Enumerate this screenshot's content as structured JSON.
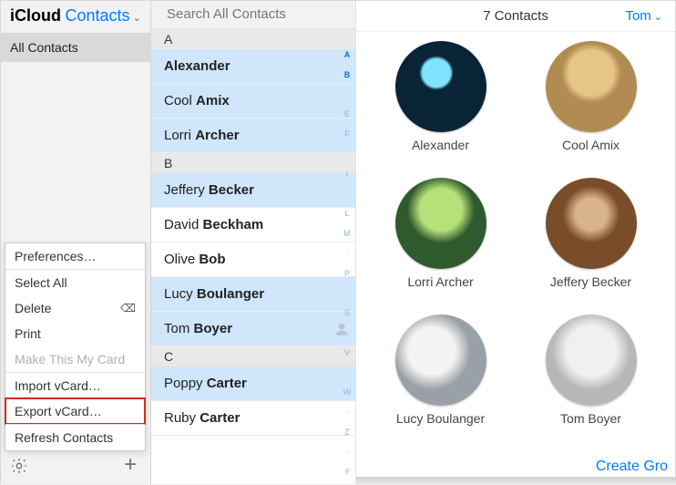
{
  "sidebar": {
    "title_icloud": "iCloud",
    "title_contacts": "Contacts",
    "all_contacts": "All Contacts"
  },
  "popover": {
    "preferences": "Preferences…",
    "select_all": "Select All",
    "delete": "Delete",
    "print": "Print",
    "make_card": "Make This My Card",
    "import_vcard": "Import vCard…",
    "export_vcard": "Export vCard…",
    "refresh": "Refresh Contacts"
  },
  "search": {
    "placeholder": "Search All Contacts"
  },
  "index_letters": [
    "A",
    "B",
    "",
    "E",
    "F",
    "",
    "I",
    "",
    "L",
    "M",
    "",
    "P",
    "",
    "S",
    "",
    "V",
    "",
    "W",
    "",
    "Z",
    "",
    "#"
  ],
  "sections": [
    {
      "letter": "A",
      "rows": [
        {
          "first": "",
          "last": "Alexander",
          "selected": true
        },
        {
          "first": "Cool",
          "last": "Amix",
          "selected": true
        },
        {
          "first": "Lorri",
          "last": "Archer",
          "selected": true
        }
      ]
    },
    {
      "letter": "B",
      "rows": [
        {
          "first": "Jeffery",
          "last": "Becker",
          "selected": true
        },
        {
          "first": "David",
          "last": "Beckham",
          "selected": false
        },
        {
          "first": "Olive",
          "last": "Bob",
          "selected": false
        },
        {
          "first": "Lucy",
          "last": "Boulanger",
          "selected": true
        },
        {
          "first": "Tom",
          "last": "Boyer",
          "selected": true,
          "me": true
        }
      ]
    },
    {
      "letter": "C",
      "rows": [
        {
          "first": "Poppy",
          "last": "Carter",
          "selected": true
        },
        {
          "first": "Ruby",
          "last": "Carter",
          "selected": false
        }
      ]
    }
  ],
  "detail": {
    "count_label": "7 Contacts",
    "user_label": "Tom",
    "create_group": "Create Gro",
    "cards": [
      {
        "name": "Alexander",
        "avatar": "av1"
      },
      {
        "name": "Cool Amix",
        "avatar": "av2"
      },
      {
        "name": "Lorri Archer",
        "avatar": "av3"
      },
      {
        "name": "Jeffery Becker",
        "avatar": "av4"
      },
      {
        "name": "Lucy Boulanger",
        "avatar": "av5"
      },
      {
        "name": "Tom Boyer",
        "avatar": "av6"
      }
    ]
  }
}
